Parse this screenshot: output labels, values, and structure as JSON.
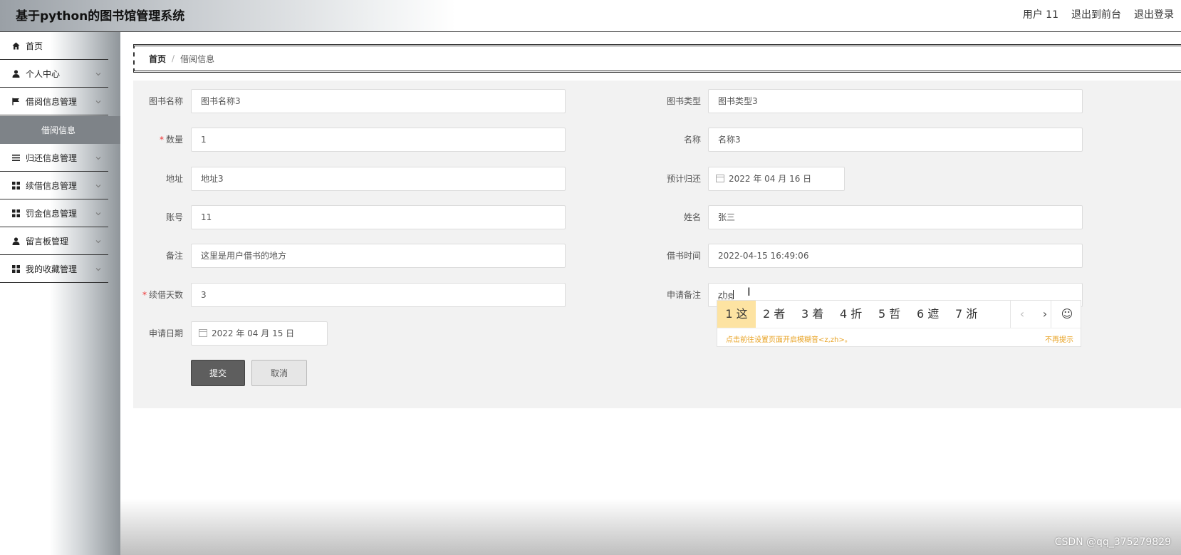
{
  "header": {
    "title": "基于python的图书馆管理系统",
    "user": "用户 11",
    "front": "退出到前台",
    "logout": "退出登录"
  },
  "sidebar": {
    "items": [
      {
        "label": "首页",
        "icon": "home-icon"
      },
      {
        "label": "个人中心",
        "icon": "user-icon"
      },
      {
        "label": "借阅信息管理",
        "icon": "flag-icon"
      },
      {
        "label": "归还信息管理",
        "icon": "list-icon"
      },
      {
        "label": "续借信息管理",
        "icon": "grid-icon"
      },
      {
        "label": "罚金信息管理",
        "icon": "grid-icon"
      },
      {
        "label": "留言板管理",
        "icon": "user-icon"
      },
      {
        "label": "我的收藏管理",
        "icon": "grid-icon"
      }
    ],
    "active_sub": "借阅信息"
  },
  "breadcrumb": {
    "home": "首页",
    "sep": "/",
    "current": "借阅信息"
  },
  "form": {
    "book_name": {
      "label": "图书名称",
      "value": "图书名称3"
    },
    "book_type": {
      "label": "图书类型",
      "value": "图书类型3"
    },
    "quantity": {
      "label": "数量",
      "value": "1",
      "required_mark": "*"
    },
    "name": {
      "label": "名称",
      "value": "名称3"
    },
    "address": {
      "label": "地址",
      "value": "地址3"
    },
    "expected_return": {
      "label": "预计归还",
      "value": "2022 年 04 月 16 日"
    },
    "account": {
      "label": "账号",
      "value": "11"
    },
    "realname": {
      "label": "姓名",
      "value": "张三"
    },
    "remark": {
      "label": "备注",
      "value": "这里是用户借书的地方"
    },
    "borrow_time": {
      "label": "借书时间",
      "value": "2022-04-15 16:49:06"
    },
    "renew_days": {
      "label": "续借天数",
      "value": "3",
      "required_mark": "*"
    },
    "apply_remark": {
      "label": "申请备注",
      "value": "zhe"
    },
    "apply_date": {
      "label": "申请日期",
      "value": "2022 年 04 月 15 日"
    },
    "submit": "提交",
    "cancel": "取消"
  },
  "ime": {
    "candidates": [
      "1 这",
      "2 者",
      "3 着",
      "4 折",
      "5 哲",
      "6 遮",
      "7 浙"
    ],
    "prev": "‹",
    "next": "›",
    "emoji": "☺",
    "hint": "点击前往设置页面开启模糊音<z,zh>。",
    "dismiss": "不再提示"
  },
  "watermark": "CSDN @qq_375279829"
}
